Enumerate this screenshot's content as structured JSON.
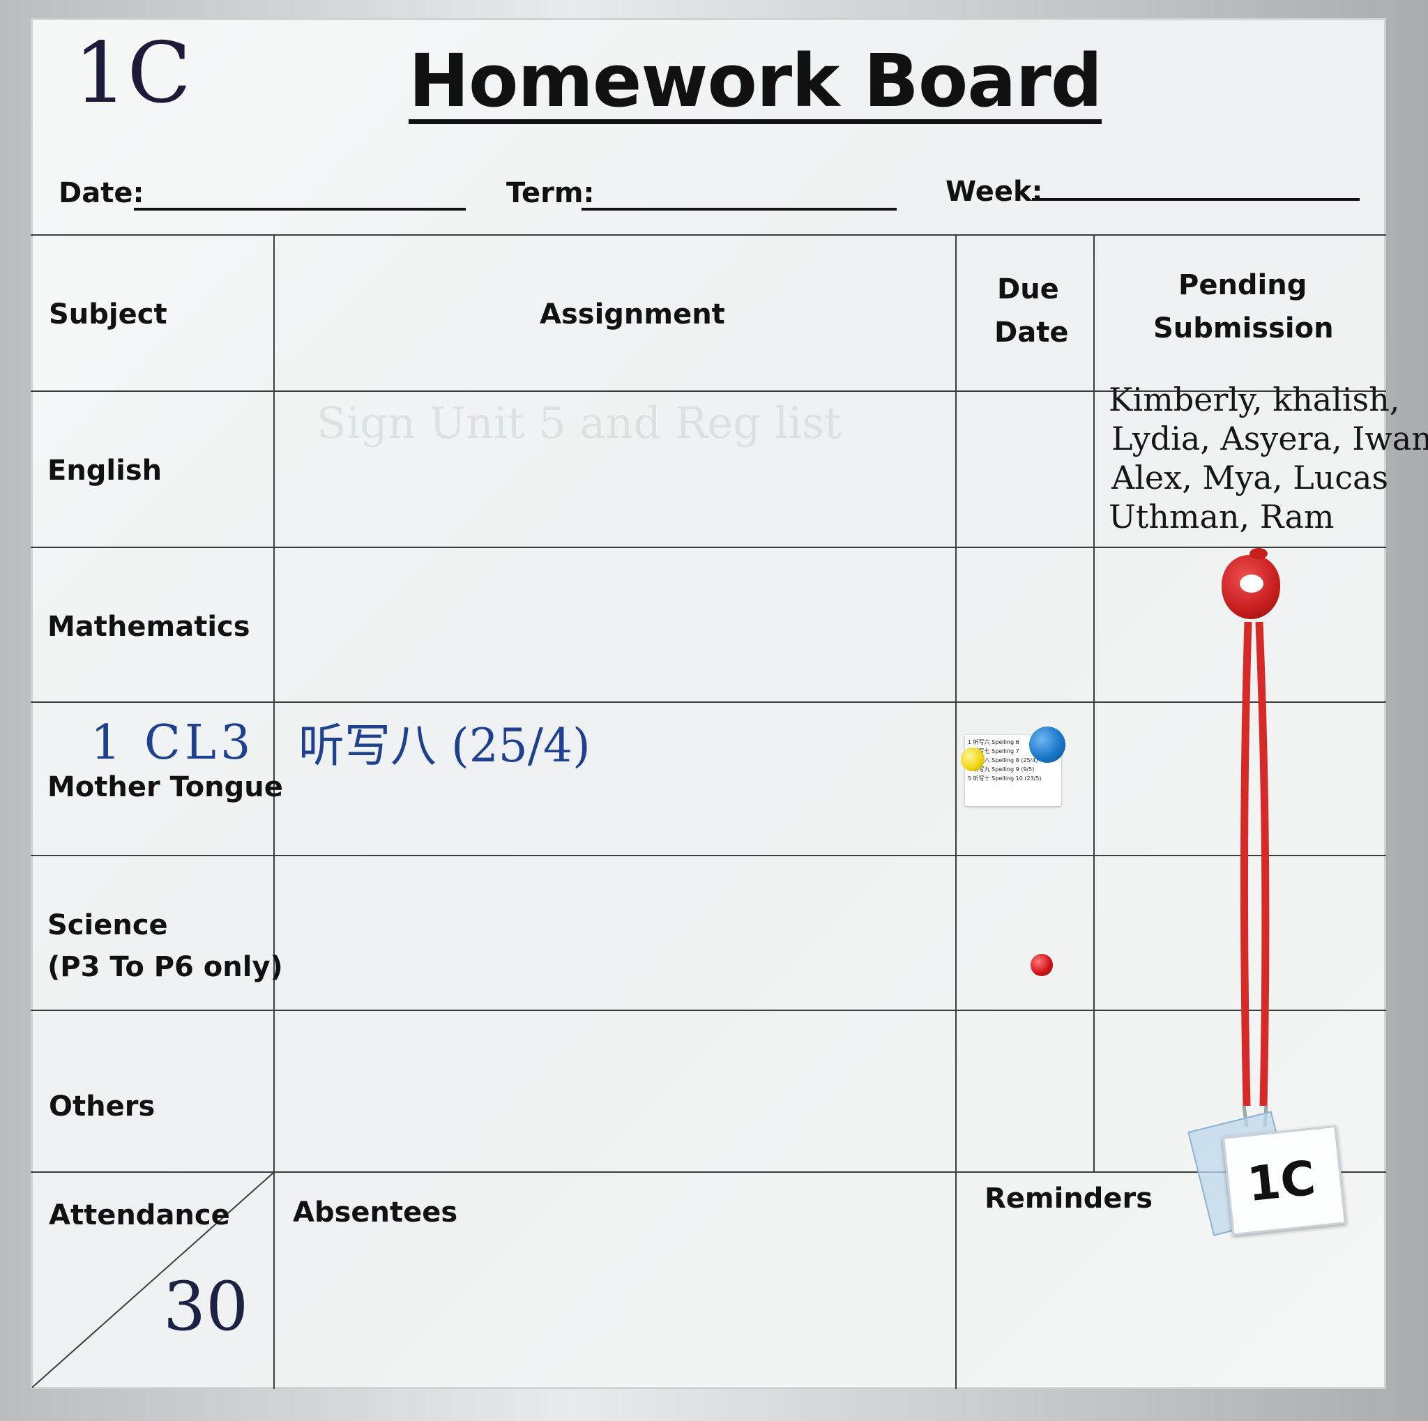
{
  "board": {
    "class_tag": "1C",
    "title": "Homework Board",
    "fields": {
      "date_label": "Date:",
      "term_label": "Term:",
      "week_label": "Week:"
    },
    "columns": {
      "subject": "Subject",
      "assignment": "Assignment",
      "due_line1": "Due",
      "due_line2": "Date",
      "pending_line1": "Pending",
      "pending_line2": "Submission"
    },
    "subjects": {
      "english": "English",
      "mathematics": "Mathematics",
      "mt_code": "1 CL3",
      "mother_tongue": "Mother Tongue",
      "science_line1": "Science",
      "science_line2": "(P3 To P6 only)",
      "others": "Others"
    },
    "english_erased": "Sign Unit 5 and Reg list",
    "mt_assignment": "听写八 (25/4)",
    "english_pending": [
      "Kimberly, khalish,",
      "Lydia, Asyera, Iwan",
      "Alex,  Mya, Lucas",
      "Uthman, Ram"
    ],
    "attendance": {
      "label": "Attendance",
      "count": "30"
    },
    "absentees_label": "Absentees",
    "reminders_label": "Reminders",
    "badge_card": "1C",
    "note_lines": [
      "1 听写六 Spelling 6",
      "2 听写七 Spelling 7",
      "3 听写八 Spelling 8 (25/4)",
      "4 听写九 Spelling 9 (9/5)",
      "5 听写十 Spelling 10 (23/5)"
    ]
  },
  "colors": {
    "marker_blue": "#1f3f8f",
    "marker_black": "#151515",
    "lanyard": "#d62a28",
    "magnet_blue": "#1b78c9",
    "magnet_yellow": "#f2d616",
    "magnet_red": "#d4141c"
  }
}
